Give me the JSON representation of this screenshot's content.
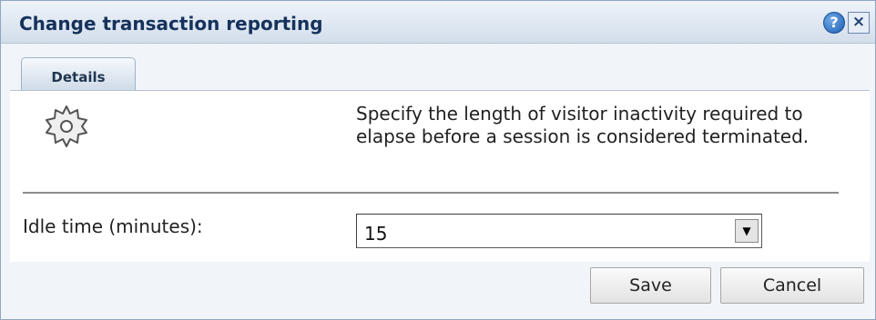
{
  "dialog": {
    "title": "Change transaction reporting",
    "help_icon": "help-icon",
    "help_glyph": "?",
    "close_icon": "close-icon",
    "close_glyph": "×"
  },
  "tabs": [
    {
      "label": "Details",
      "active": true
    }
  ],
  "details": {
    "icon": "gear-icon",
    "description": "Specify the length of visitor inactivity required to elapse before a session is considered terminated.",
    "idle_time": {
      "label": "Idle time (minutes):",
      "value": "15",
      "arrow_glyph": "▼"
    }
  },
  "buttons": {
    "save": "Save",
    "cancel": "Cancel"
  },
  "colors": {
    "title_text": "#15325c",
    "titlebar_top": "#eef3f9",
    "titlebar_bottom": "#d3deeb",
    "dialog_bg": "#f1f4f8"
  }
}
